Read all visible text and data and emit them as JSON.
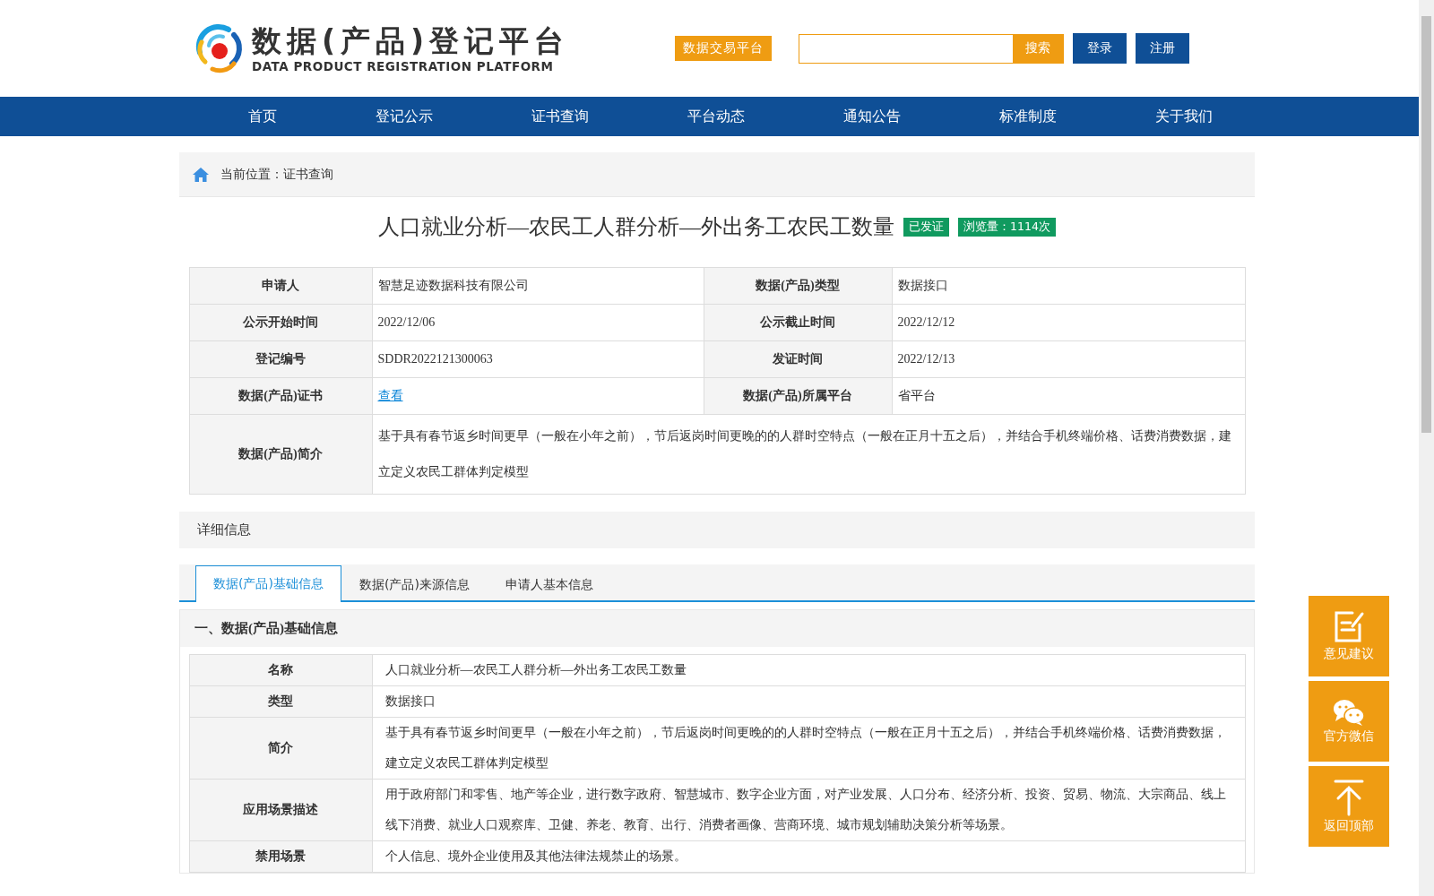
{
  "header": {
    "logo_title": "数据(产品)登记平台",
    "logo_subtitle": "DATA PRODUCT REGISTRATION PLATFORM",
    "trade_link": "数据交易平台",
    "search_button": "搜索",
    "buttons": [
      "登录",
      "注册"
    ]
  },
  "nav": [
    {
      "label": "首页"
    },
    {
      "label": "登记公示"
    },
    {
      "label": "证书查询"
    },
    {
      "label": "平台动态"
    },
    {
      "label": "通知公告"
    },
    {
      "label": "标准制度"
    },
    {
      "label": "关于我们"
    }
  ],
  "breadcrumb": "当前位置：证书查询",
  "product": {
    "title": "人口就业分析—农民工人群分析—外出务工农民工数量",
    "status_badge": "已发证",
    "views_badge": "浏览量：1114次"
  },
  "summary": [
    {
      "cells": [
        {
          "label": "申请人",
          "value": "智慧足迹数据科技有限公司",
          "kind": "text"
        },
        {
          "label": "数据(产品)类型",
          "value": "数据接口",
          "kind": "text"
        }
      ]
    },
    {
      "cells": [
        {
          "label": "公示开始时间",
          "value": "2022/12/06",
          "kind": "text"
        },
        {
          "label": "公示截止时间",
          "value": "2022/12/12",
          "kind": "text"
        }
      ]
    },
    {
      "cells": [
        {
          "label": "登记编号",
          "value": "SDDR2022121300063",
          "kind": "text"
        },
        {
          "label": "发证时间",
          "value": "2022/12/13",
          "kind": "text"
        }
      ]
    },
    {
      "cells": [
        {
          "label": "数据(产品)证书",
          "value": "查看",
          "kind": "link"
        },
        {
          "label": "数据(产品)所属平台",
          "value": "省平台",
          "kind": "text"
        }
      ]
    },
    {
      "cells": [
        {
          "label": "数据(产品)简介",
          "value": "基于具有春节返乡时间更早（一般在小年之前），节后返岗时间更晚的的人群时空特点（一般在正月十五之后），并结合手机终端价格、话费消费数据，建立定义农民工群体判定模型",
          "kind": "text"
        }
      ]
    }
  ],
  "details": {
    "heading": "详细信息",
    "tabs": [
      {
        "label": "数据(产品)基础信息",
        "selected": true
      },
      {
        "label": "数据(产品)来源信息",
        "selected": false
      },
      {
        "label": "申请人基本信息",
        "selected": false
      }
    ],
    "section_title": "一、数据(产品)基础信息",
    "rows": [
      {
        "label": "名称",
        "value": "人口就业分析—农民工人群分析—外出务工农民工数量"
      },
      {
        "label": "类型",
        "value": "数据接口"
      },
      {
        "label": "简介",
        "value": "基于具有春节返乡时间更早（一般在小年之前），节后返岗时间更晚的的人群时空特点（一般在正月十五之后），并结合手机终端价格、话费消费数据，建立定义农民工群体判定模型"
      },
      {
        "label": "应用场景描述",
        "value": "用于政府部门和零售、地产等企业，进行数字政府、智慧城市、数字企业方面，对产业发展、人口分布、经济分析、投资、贸易、物流、大宗商品、线上线下消费、就业人口观察库、卫健、养老、教育、出行、消费者画像、营商环境、城市规划辅助决策分析等场景。"
      },
      {
        "label": "禁用场景",
        "value": "个人信息、境外企业使用及其他法律法规禁止的场景。"
      }
    ]
  },
  "side_buttons": [
    {
      "kind": "feedback",
      "label": "意见建议"
    },
    {
      "kind": "wechat",
      "label": "官方微信"
    },
    {
      "kind": "top",
      "label": "返回顶部"
    }
  ]
}
